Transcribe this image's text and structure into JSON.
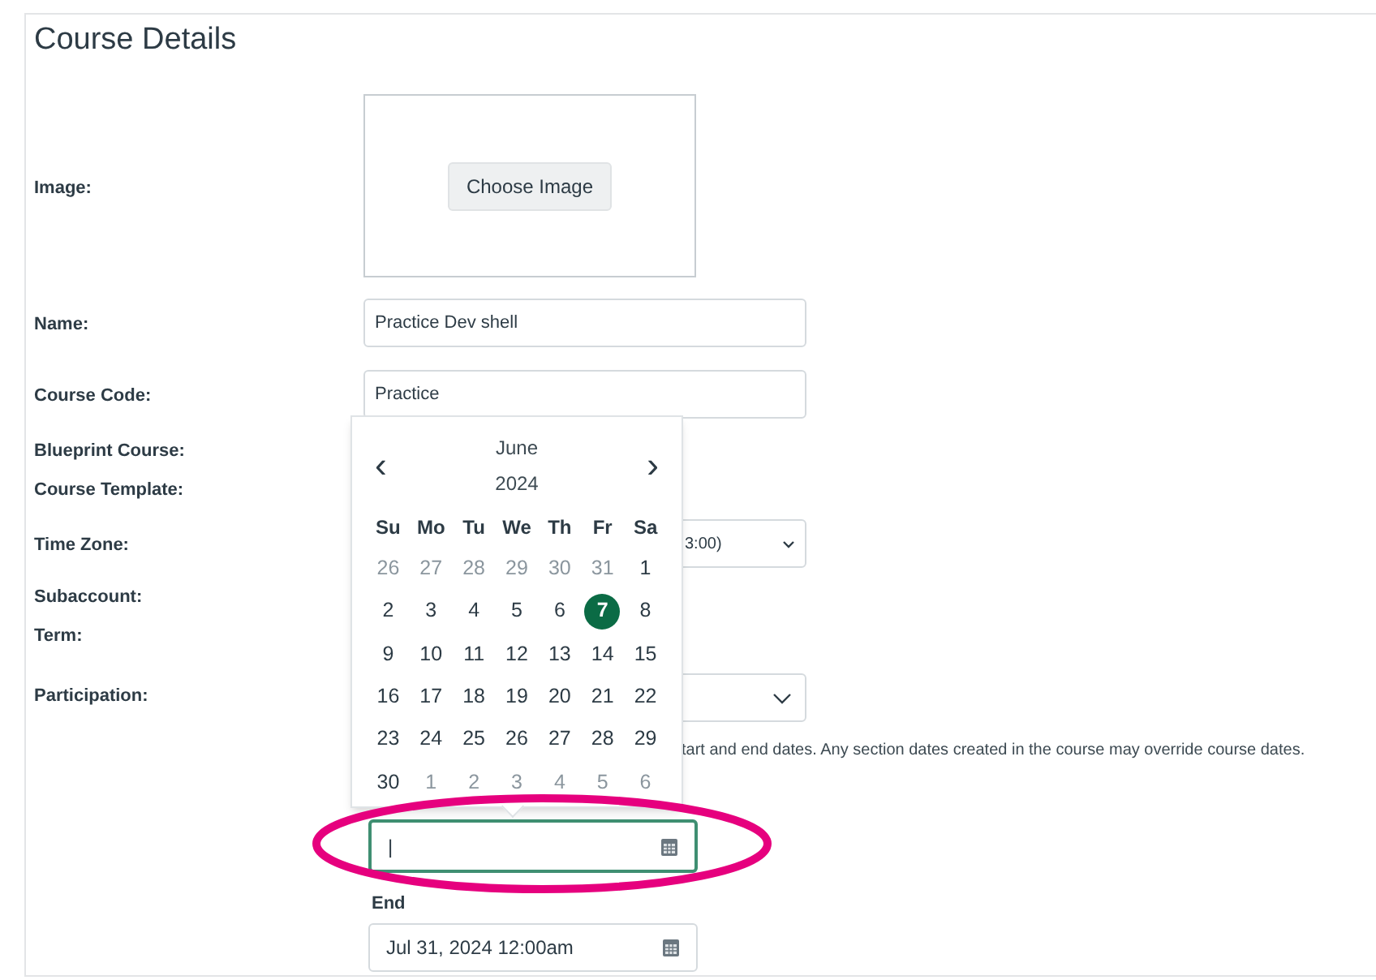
{
  "title": "Course Details",
  "image": {
    "label": "Image:",
    "button": "Choose Image"
  },
  "name": {
    "label": "Name:",
    "value": "Practice Dev shell"
  },
  "course_code": {
    "label": "Course Code:",
    "value": "Practice"
  },
  "blueprint": {
    "label": "Blueprint Course:"
  },
  "template": {
    "label": "Course Template:"
  },
  "time_zone": {
    "label": "Time Zone:",
    "value": "3:00)"
  },
  "subaccount": {
    "label": "Subaccount:"
  },
  "term": {
    "label": "Term:"
  },
  "participation": {
    "label": "Participation:",
    "help": "tart and end dates. Any section dates created in the course may override course dates."
  },
  "start": {
    "value": "|",
    "focused": true
  },
  "end": {
    "label": "End",
    "value": "Jul 31, 2024 12:00am",
    "focused": false
  },
  "calendar": {
    "month": "June",
    "year": "2024",
    "prev": "‹",
    "next": "›",
    "weekdays": [
      "Su",
      "Mo",
      "Tu",
      "We",
      "Th",
      "Fr",
      "Sa"
    ],
    "days": [
      {
        "label": "26",
        "outside": true,
        "selected": false
      },
      {
        "label": "27",
        "outside": true,
        "selected": false
      },
      {
        "label": "28",
        "outside": true,
        "selected": false
      },
      {
        "label": "29",
        "outside": true,
        "selected": false
      },
      {
        "label": "30",
        "outside": true,
        "selected": false
      },
      {
        "label": "31",
        "outside": true,
        "selected": false
      },
      {
        "label": "1",
        "outside": false,
        "selected": false
      },
      {
        "label": "2",
        "outside": false,
        "selected": false
      },
      {
        "label": "3",
        "outside": false,
        "selected": false
      },
      {
        "label": "4",
        "outside": false,
        "selected": false
      },
      {
        "label": "5",
        "outside": false,
        "selected": false
      },
      {
        "label": "6",
        "outside": false,
        "selected": false
      },
      {
        "label": "7",
        "outside": false,
        "selected": true
      },
      {
        "label": "8",
        "outside": false,
        "selected": false
      },
      {
        "label": "9",
        "outside": false,
        "selected": false
      },
      {
        "label": "10",
        "outside": false,
        "selected": false
      },
      {
        "label": "11",
        "outside": false,
        "selected": false
      },
      {
        "label": "12",
        "outside": false,
        "selected": false
      },
      {
        "label": "13",
        "outside": false,
        "selected": false
      },
      {
        "label": "14",
        "outside": false,
        "selected": false
      },
      {
        "label": "15",
        "outside": false,
        "selected": false
      },
      {
        "label": "16",
        "outside": false,
        "selected": false
      },
      {
        "label": "17",
        "outside": false,
        "selected": false
      },
      {
        "label": "18",
        "outside": false,
        "selected": false
      },
      {
        "label": "19",
        "outside": false,
        "selected": false
      },
      {
        "label": "20",
        "outside": false,
        "selected": false
      },
      {
        "label": "21",
        "outside": false,
        "selected": false
      },
      {
        "label": "22",
        "outside": false,
        "selected": false
      },
      {
        "label": "23",
        "outside": false,
        "selected": false
      },
      {
        "label": "24",
        "outside": false,
        "selected": false
      },
      {
        "label": "25",
        "outside": false,
        "selected": false
      },
      {
        "label": "26",
        "outside": false,
        "selected": false
      },
      {
        "label": "27",
        "outside": false,
        "selected": false
      },
      {
        "label": "28",
        "outside": false,
        "selected": false
      },
      {
        "label": "29",
        "outside": false,
        "selected": false
      },
      {
        "label": "30",
        "outside": false,
        "selected": false
      },
      {
        "label": "1",
        "outside": true,
        "selected": false
      },
      {
        "label": "2",
        "outside": true,
        "selected": false
      },
      {
        "label": "3",
        "outside": true,
        "selected": false
      },
      {
        "label": "4",
        "outside": true,
        "selected": false
      },
      {
        "label": "5",
        "outside": true,
        "selected": false
      },
      {
        "label": "6",
        "outside": true,
        "selected": false
      }
    ]
  }
}
